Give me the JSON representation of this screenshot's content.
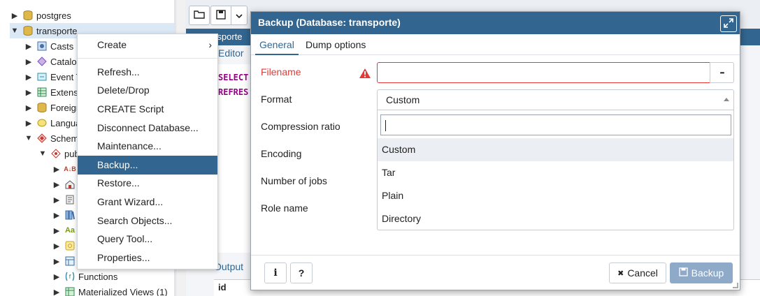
{
  "tree": {
    "nodes": [
      {
        "label": "postgres",
        "icon": "database-icon"
      },
      {
        "label": "transporte",
        "icon": "database-icon"
      },
      {
        "label": "Casts",
        "icon": "casts-icon"
      },
      {
        "label": "Catalog",
        "icon": "catalog-icon"
      },
      {
        "label": "Event T",
        "icon": "event-trigger-icon"
      },
      {
        "label": "Extens",
        "icon": "extensions-icon"
      },
      {
        "label": "Foreigr",
        "icon": "foreign-data-icon"
      },
      {
        "label": "Langua",
        "icon": "languages-icon"
      },
      {
        "label": "Schem",
        "icon": "schemas-icon"
      },
      {
        "label": "pub",
        "icon": "schema-icon"
      },
      {
        "label": "",
        "icon": "collations-icon"
      },
      {
        "label": "",
        "icon": "domains-icon"
      },
      {
        "label": "",
        "icon": "fts-config-icon"
      },
      {
        "label": "",
        "icon": "fts-dictionary-icon"
      },
      {
        "label": "",
        "icon": "fts-parser-icon"
      },
      {
        "label": "",
        "icon": "fts-template-icon"
      },
      {
        "label": "",
        "icon": "foreign-tables-icon"
      },
      {
        "label": "Functions",
        "icon": "functions-icon"
      },
      {
        "label": "Materialized Views (1)",
        "icon": "materialized-views-icon"
      }
    ],
    "collations_glyph": "A↓B",
    "fts_parser_glyph": "Aa"
  },
  "query_tool": {
    "tab_label": "transporte",
    "editor_tab": "Editor",
    "sql_lines": [
      "SELECT",
      "REFRES"
    ],
    "output_tab": "Output",
    "grid_column": "id"
  },
  "context_menu": {
    "items": [
      "Create",
      "Refresh...",
      "Delete/Drop",
      "CREATE Script",
      "Disconnect Database...",
      "Maintenance...",
      "Backup...",
      "Restore...",
      "Grant Wizard...",
      "Search Objects...",
      "Query Tool...",
      "Properties..."
    ],
    "active_item": "Backup...",
    "submenu_arrow": "›"
  },
  "dialog": {
    "title": "Backup (Database: transporte)",
    "tabs": [
      "General",
      "Dump options"
    ],
    "active_tab": "General",
    "fields": {
      "filename": {
        "label": "Filename",
        "value": ""
      },
      "format": {
        "label": "Format",
        "value": "Custom"
      },
      "compression": {
        "label": "Compression ratio"
      },
      "encoding": {
        "label": "Encoding"
      },
      "jobs": {
        "label": "Number of jobs"
      },
      "role": {
        "label": "Role name"
      }
    },
    "browse_glyph": "•••",
    "format_options": [
      "Custom",
      "Tar",
      "Plain",
      "Directory"
    ],
    "highlighted_option": "Custom",
    "search_value": "",
    "buttons": {
      "info": "i",
      "help": "?",
      "cancel": "Cancel",
      "cancel_glyph": "✖",
      "backup": "Backup"
    }
  },
  "colors": {
    "brand": "#326690",
    "error": "#e53935",
    "menu_active": "#326690",
    "backup_disabled": "#8eaac8"
  }
}
